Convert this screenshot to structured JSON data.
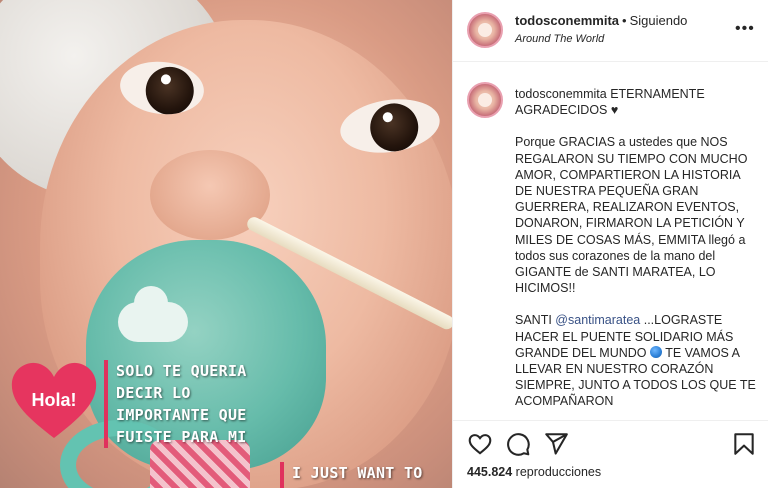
{
  "media": {
    "sticker_text": "Hola!",
    "caption_es": [
      "SOLO TE QUERIA",
      "DECIR LO",
      "IMPORTANTE QUE",
      "FUISTE PARA MI"
    ],
    "caption_en": "I JUST WANT TO TELL"
  },
  "header": {
    "username": "todosconemmita",
    "separator": "•",
    "follow_status": "Siguiendo",
    "location": "Around The World",
    "more": "•••"
  },
  "post": {
    "username": "todosconemmita",
    "headline": "ETERNAMENTE AGRADECIDOS ♥",
    "paragraph1": "Porque GRACIAS a ustedes que NOS REGALARON SU TIEMPO CON MUCHO AMOR, COMPARTIERON LA HISTORIA DE NUESTRA PEQUEÑA GRAN GUERRERA, REALIZARON EVENTOS, DONARON, FIRMARON LA PETICIÓN Y MILES DE COSAS MÁS, EMMITA llegó a todos sus corazones de la mano del GIGANTE de SANTI MARATEA, LO HICIMOS!!",
    "p2_prefix": "SANTI ",
    "p2_mention": "@santimaratea",
    "p2_middle": " ...LOGRASTE HACER EL PUENTE SOLIDARIO MÁS GRANDE DEL MUNDO ",
    "p2_suffix": " TE VAMOS A LLEVAR EN NUESTRO CORAZÓN SIEMPRE, JUNTO A TODOS LOS QUE TE ACOMPAÑARON"
  },
  "footer": {
    "views_count": "445.824",
    "views_label": " reproducciones"
  },
  "icons": [
    "heart-icon",
    "comment-icon",
    "share-icon",
    "bookmark-icon",
    "more-icon",
    "globe-icon"
  ],
  "colors": {
    "accent_pink": "#e0325d",
    "mention_blue": "#385185"
  }
}
